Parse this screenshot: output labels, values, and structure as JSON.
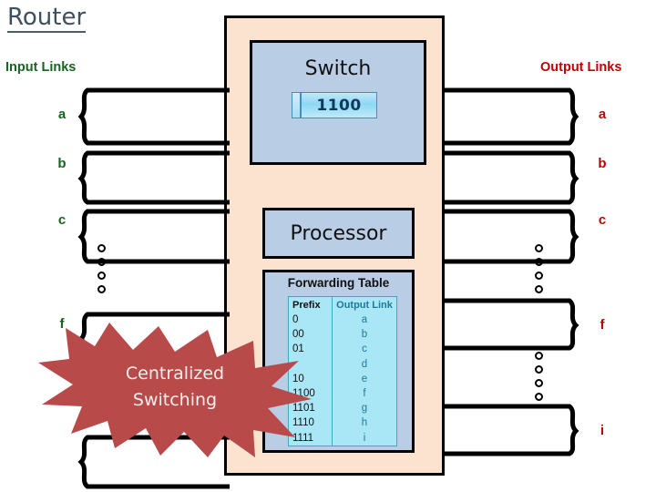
{
  "title": "Router",
  "sections": {
    "input_links_label": "Input Links",
    "output_links_label": "Output Links"
  },
  "input_links": [
    {
      "letter": "a"
    },
    {
      "letter": "b"
    },
    {
      "letter": "c"
    },
    {
      "letter": "f"
    }
  ],
  "output_links": [
    {
      "letter": "a"
    },
    {
      "letter": "b"
    },
    {
      "letter": "c"
    },
    {
      "letter": "f"
    },
    {
      "letter": "i"
    }
  ],
  "switch": {
    "title": "Switch",
    "packet_value": "1100"
  },
  "processor": {
    "title": "Processor"
  },
  "forwarding_table": {
    "title": "Forwarding Table",
    "columns": [
      "Prefix",
      "Output Link"
    ],
    "rows": [
      {
        "prefix": "0",
        "output_link": "a"
      },
      {
        "prefix": "00",
        "output_link": "b"
      },
      {
        "prefix": "01",
        "output_link": "c"
      },
      {
        "prefix": "",
        "output_link": "d"
      },
      {
        "prefix": "10",
        "output_link": "e"
      },
      {
        "prefix": "1100",
        "output_link": "f"
      },
      {
        "prefix": "1101",
        "output_link": "g"
      },
      {
        "prefix": "1110",
        "output_link": "h"
      },
      {
        "prefix": "1111",
        "output_link": "i"
      }
    ]
  },
  "callout": {
    "line1": "Centralized",
    "line2": "Switching"
  },
  "colors": {
    "title": "#3f4f5e",
    "input_label": "#17631f",
    "output_label": "#c00000",
    "chassis": "#fce3d0",
    "module": "#b9cde5",
    "table": "#a9e7f7",
    "callout": "#b84a4a",
    "packet_text": "#0d3a58"
  }
}
